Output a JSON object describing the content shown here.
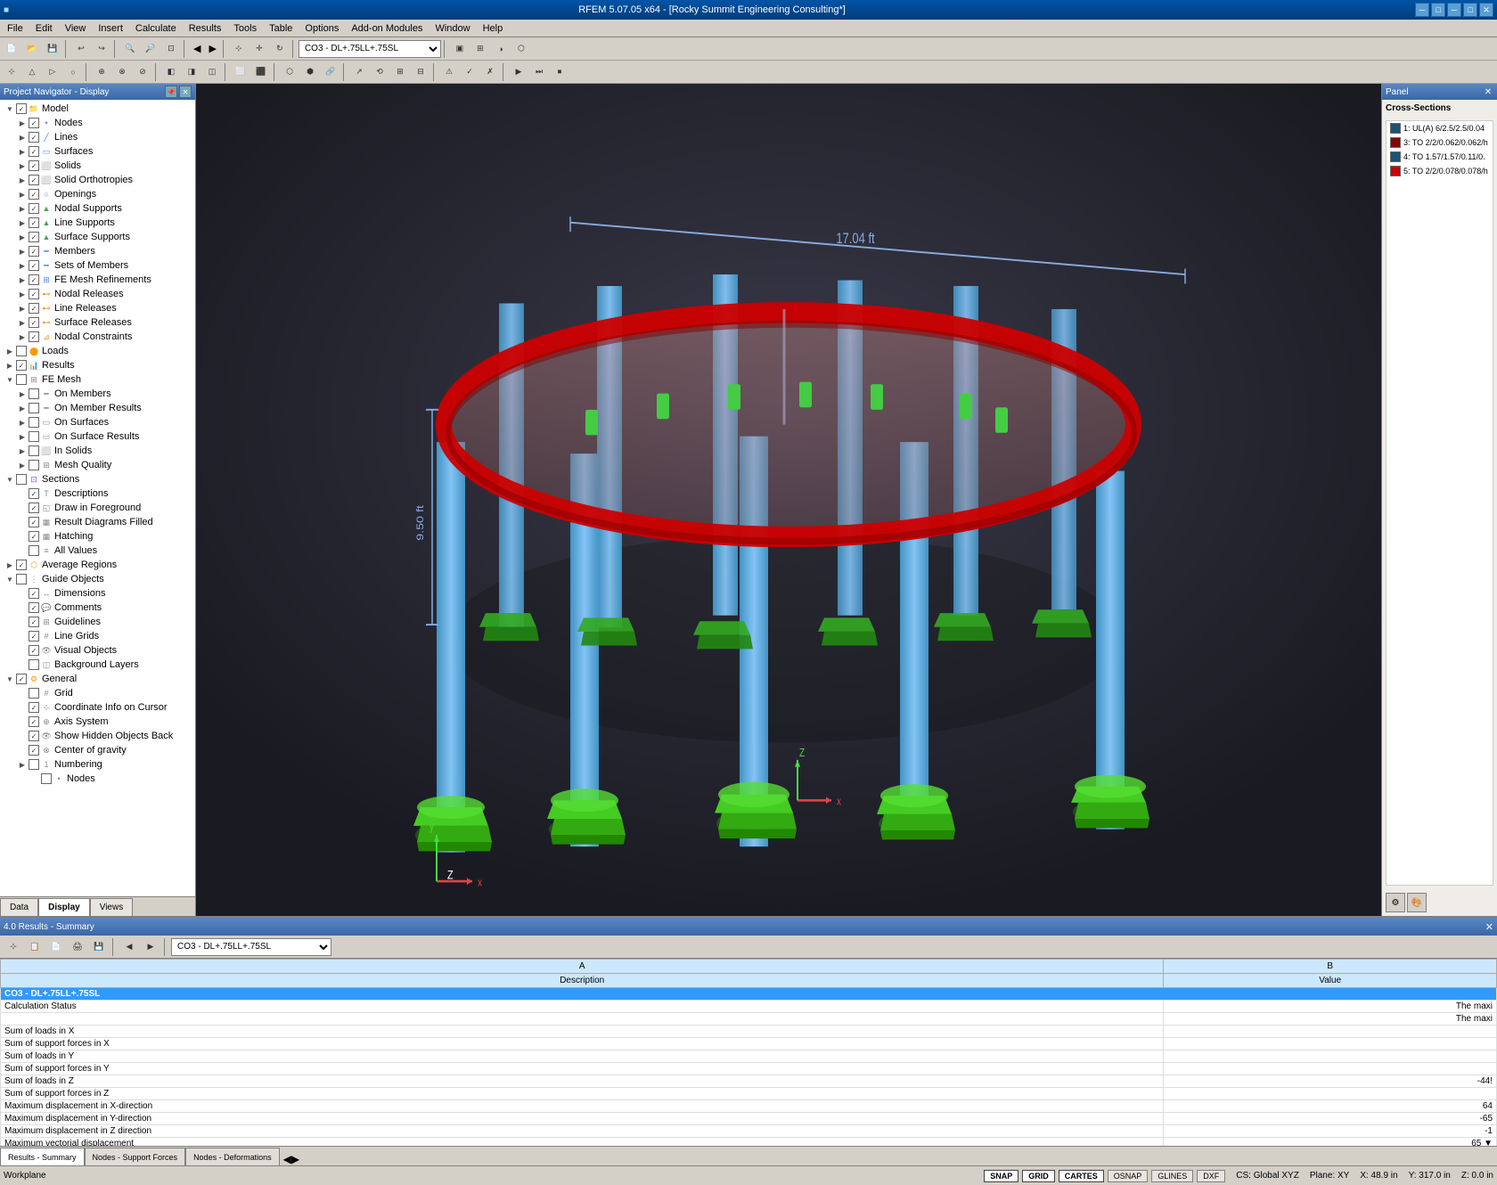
{
  "titlebar": {
    "title": "RFEM 5.07.05 x64 - [Rocky Summit Engineering Consulting*]",
    "min_label": "─",
    "max_label": "□",
    "close_label": "✕",
    "app_min": "─",
    "app_max": "□",
    "app_close": "✕"
  },
  "menubar": {
    "items": [
      "File",
      "Edit",
      "View",
      "Insert",
      "Calculate",
      "Results",
      "Tools",
      "Table",
      "Options",
      "Add-on Modules",
      "Window",
      "Help"
    ]
  },
  "toolbar1": {
    "combo_value": "CO3 - DL+.75LL+.75SL"
  },
  "nav": {
    "title": "Project Navigator - Display",
    "tabs": [
      "Data",
      "Display",
      "Views"
    ],
    "active_tab": "Display"
  },
  "tree": {
    "items": [
      {
        "label": "Model",
        "level": 1,
        "expanded": true,
        "checked": true,
        "icon": "folder"
      },
      {
        "label": "Nodes",
        "level": 2,
        "expanded": false,
        "checked": true,
        "icon": "dot"
      },
      {
        "label": "Lines",
        "level": 2,
        "expanded": false,
        "checked": true,
        "icon": "line"
      },
      {
        "label": "Surfaces",
        "level": 2,
        "expanded": false,
        "checked": true,
        "icon": "surface"
      },
      {
        "label": "Solids",
        "level": 2,
        "expanded": false,
        "checked": true,
        "icon": "solid"
      },
      {
        "label": "Solid Orthotropies",
        "level": 2,
        "expanded": false,
        "checked": true,
        "icon": "solid"
      },
      {
        "label": "Openings",
        "level": 2,
        "expanded": false,
        "checked": true,
        "icon": "opening"
      },
      {
        "label": "Nodal Supports",
        "level": 2,
        "expanded": false,
        "checked": true,
        "icon": "support"
      },
      {
        "label": "Line Supports",
        "level": 2,
        "expanded": false,
        "checked": true,
        "icon": "support"
      },
      {
        "label": "Surface Supports",
        "level": 2,
        "expanded": false,
        "checked": true,
        "icon": "support"
      },
      {
        "label": "Members",
        "level": 2,
        "expanded": false,
        "checked": true,
        "icon": "member"
      },
      {
        "label": "Sets of Members",
        "level": 2,
        "expanded": false,
        "checked": true,
        "icon": "member"
      },
      {
        "label": "FE Mesh Refinements",
        "level": 2,
        "expanded": false,
        "checked": true,
        "icon": "mesh"
      },
      {
        "label": "Nodal Releases",
        "level": 2,
        "expanded": false,
        "checked": true,
        "icon": "release"
      },
      {
        "label": "Line Releases",
        "level": 2,
        "expanded": false,
        "checked": true,
        "icon": "release"
      },
      {
        "label": "Surface Releases",
        "level": 2,
        "expanded": false,
        "checked": true,
        "icon": "release"
      },
      {
        "label": "Nodal Constraints",
        "level": 2,
        "expanded": false,
        "checked": true,
        "icon": "constraint"
      },
      {
        "label": "Loads",
        "level": 1,
        "expanded": false,
        "checked": false,
        "icon": "loads"
      },
      {
        "label": "Results",
        "level": 1,
        "expanded": false,
        "checked": true,
        "icon": "results"
      },
      {
        "label": "FE Mesh",
        "level": 1,
        "expanded": true,
        "checked": false,
        "icon": "mesh"
      },
      {
        "label": "On Members",
        "level": 2,
        "expanded": false,
        "checked": false,
        "icon": "member"
      },
      {
        "label": "On Member Results",
        "level": 2,
        "expanded": false,
        "checked": false,
        "icon": "member"
      },
      {
        "label": "On Surfaces",
        "level": 2,
        "expanded": false,
        "checked": false,
        "icon": "surface"
      },
      {
        "label": "On Surface Results",
        "level": 2,
        "expanded": false,
        "checked": false,
        "icon": "surface"
      },
      {
        "label": "In Solids",
        "level": 2,
        "expanded": false,
        "checked": false,
        "icon": "solid"
      },
      {
        "label": "Mesh Quality",
        "level": 2,
        "expanded": false,
        "checked": false,
        "icon": "mesh"
      },
      {
        "label": "Sections",
        "level": 1,
        "expanded": true,
        "checked": false,
        "icon": "folder"
      },
      {
        "label": "Descriptions",
        "level": 2,
        "expanded": false,
        "checked": true,
        "icon": "text"
      },
      {
        "label": "Draw in Foreground",
        "level": 2,
        "expanded": false,
        "checked": true,
        "icon": "draw"
      },
      {
        "label": "Result Diagrams Filled",
        "level": 2,
        "expanded": false,
        "checked": true,
        "icon": "diagram"
      },
      {
        "label": "Hatching",
        "level": 2,
        "expanded": false,
        "checked": true,
        "icon": "hatch"
      },
      {
        "label": "All Values",
        "level": 2,
        "expanded": false,
        "checked": false,
        "icon": "values"
      },
      {
        "label": "Average Regions",
        "level": 1,
        "expanded": false,
        "checked": true,
        "icon": "region"
      },
      {
        "label": "Guide Objects",
        "level": 1,
        "expanded": true,
        "checked": false,
        "icon": "guide"
      },
      {
        "label": "Dimensions",
        "level": 2,
        "expanded": false,
        "checked": true,
        "icon": "dim"
      },
      {
        "label": "Comments",
        "level": 2,
        "expanded": false,
        "checked": true,
        "icon": "comment"
      },
      {
        "label": "Guidelines",
        "level": 2,
        "expanded": false,
        "checked": true,
        "icon": "guideline"
      },
      {
        "label": "Line Grids",
        "level": 2,
        "expanded": false,
        "checked": true,
        "icon": "grid"
      },
      {
        "label": "Visual Objects",
        "level": 2,
        "expanded": false,
        "checked": true,
        "icon": "visual"
      },
      {
        "label": "Background Layers",
        "level": 2,
        "expanded": false,
        "checked": false,
        "icon": "layer"
      },
      {
        "label": "General",
        "level": 1,
        "expanded": true,
        "checked": true,
        "icon": "folder"
      },
      {
        "label": "Grid",
        "level": 2,
        "expanded": false,
        "checked": false,
        "icon": "grid"
      },
      {
        "label": "Coordinate Info on Cursor",
        "level": 2,
        "expanded": false,
        "checked": true,
        "icon": "cursor"
      },
      {
        "label": "Axis System",
        "level": 2,
        "expanded": false,
        "checked": true,
        "icon": "axis"
      },
      {
        "label": "Show Hidden Objects Back",
        "level": 2,
        "expanded": false,
        "checked": true,
        "icon": "hidden"
      },
      {
        "label": "Center of gravity",
        "level": 2,
        "expanded": false,
        "checked": true,
        "icon": "gravity"
      },
      {
        "label": "Numbering",
        "level": 2,
        "expanded": false,
        "checked": false,
        "icon": "number"
      },
      {
        "label": "Nodes",
        "level": 3,
        "expanded": false,
        "checked": false,
        "icon": "dot"
      }
    ]
  },
  "panel": {
    "title": "Panel",
    "close_label": "✕",
    "cross_sections_label": "Cross-Sections",
    "items": [
      {
        "id": 1,
        "label": "1: UL(A) 6/2.5/2.5/0.04",
        "color": "#1a5276"
      },
      {
        "id": 3,
        "label": "3: TO 2/2/0.062/0.062/h",
        "color": "#8b0000"
      },
      {
        "id": 4,
        "label": "4: TO 1.57/1.57/0.11/0.",
        "color": "#1a5276"
      },
      {
        "id": 5,
        "label": "5: TO 2/2/0.078/0.078/h",
        "color": "#cc0000"
      }
    ]
  },
  "results_panel": {
    "title": "4.0 Results - Summary",
    "close_label": "✕",
    "combo_value": "CO3 - DL+.75LL+.75SL",
    "col_a": "A",
    "col_b": "B",
    "col_description": "Description",
    "col_value": "Value",
    "section_label": "CO3 - DL+.75LL+.75SL",
    "rows": [
      {
        "description": "Calculation Status",
        "value": "The maxi"
      },
      {
        "description": "",
        "value": "The maxi"
      },
      {
        "description": "Sum of loads in X",
        "value": ""
      },
      {
        "description": "Sum of support forces in X",
        "value": ""
      },
      {
        "description": "Sum of loads in Y",
        "value": ""
      },
      {
        "description": "Sum of support forces in Y",
        "value": ""
      },
      {
        "description": "Sum of loads in Z",
        "value": "-44!"
      },
      {
        "description": "Sum of support forces in Z",
        "value": ""
      },
      {
        "description": "Maximum displacement in X-direction",
        "value": "64"
      },
      {
        "description": "Maximum displacement in Y-direction",
        "value": "-65"
      },
      {
        "description": "Maximum displacement in Z direction",
        "value": "-1"
      },
      {
        "description": "Maximum vectorial displacement",
        "value": "65 ▼"
      }
    ],
    "tabs": [
      "Results - Summary",
      "Nodes - Support Forces",
      "Nodes - Deformations"
    ]
  },
  "statusbar": {
    "workplane_label": "Workplane",
    "snap": "SNAP",
    "grid": "GRID",
    "cartes": "CARTES",
    "osnap": "OSNAP",
    "glines": "GLINES",
    "dxf": "DXF",
    "cs_label": "CS: Global XYZ",
    "plane_label": "Plane: XY",
    "x_label": "X: 48.9 in",
    "y_label": "Y: 317.0 in",
    "z_label": "Z: 0.0 in"
  },
  "scene": {
    "dimension_label": "17.04 ft",
    "height_label": "9.50 ft"
  }
}
